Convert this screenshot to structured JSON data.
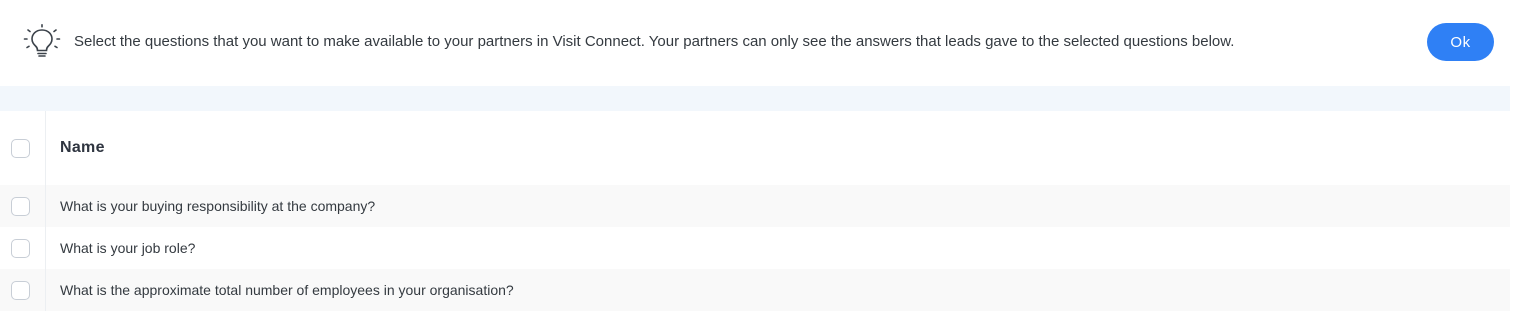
{
  "banner": {
    "icon": "lightbulb-icon",
    "text": "Select the questions that you want to make available to your partners in Visit Connect. Your partners can only see the answers that leads gave to the selected questions below.",
    "ok_label": "Ok",
    "accent_color": "#2f80f5"
  },
  "table": {
    "header": {
      "name_label": "Name"
    },
    "rows": [
      {
        "name": "What is your buying responsibility at the company?"
      },
      {
        "name": "What is your job role?"
      },
      {
        "name": "What is the approximate total number of employees in your organisation?"
      }
    ]
  }
}
